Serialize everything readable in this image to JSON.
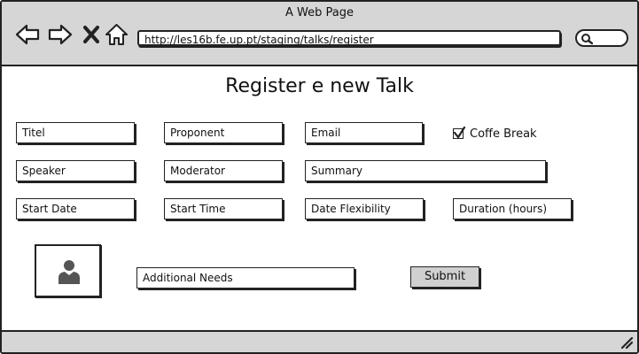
{
  "window": {
    "title": "A Web Page"
  },
  "browser": {
    "url": "http://les16b.fe.up.pt/staging/talks/register"
  },
  "page": {
    "heading": "Register e new Talk",
    "fields": {
      "titel": "Titel",
      "proponent": "Proponent",
      "email": "Email",
      "speaker": "Speaker",
      "moderator": "Moderator",
      "summary": "Summary",
      "start_date": "Start Date",
      "start_time": "Start Time",
      "date_flexibility": "Date Flexibility",
      "duration": "Duration (hours)",
      "additional_needs": "Additional Needs"
    },
    "coffee_break": {
      "label": "Coffe Break",
      "checked": true
    },
    "submit_label": "Submit"
  }
}
